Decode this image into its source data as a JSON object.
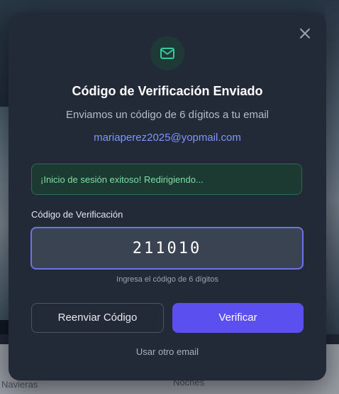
{
  "background": {
    "bottom_left_label": "Navieras",
    "bottom_right_label": "Noches"
  },
  "modal": {
    "close_icon": "close-icon",
    "header_icon": "mail-icon",
    "title": "Código de Verificación Enviado",
    "subtitle": "Enviamos un código de 6 dígitos a tu email",
    "email": "mariaperez2025@yopmail.com",
    "alert_text": "¡Inicio de sesión exitoso! Redirigiendo...",
    "field_label": "Código de Verificación",
    "code_value": "211010",
    "hint": "Ingresa el código de 6 dígitos",
    "resend_label": "Reenviar Código",
    "verify_label": "Verificar",
    "other_email_label": "Usar otro email"
  },
  "colors": {
    "modal_bg": "#232a37",
    "accent": "#5b4ff0",
    "success_text": "#7ae0a8",
    "email_link": "#7f95ff"
  }
}
